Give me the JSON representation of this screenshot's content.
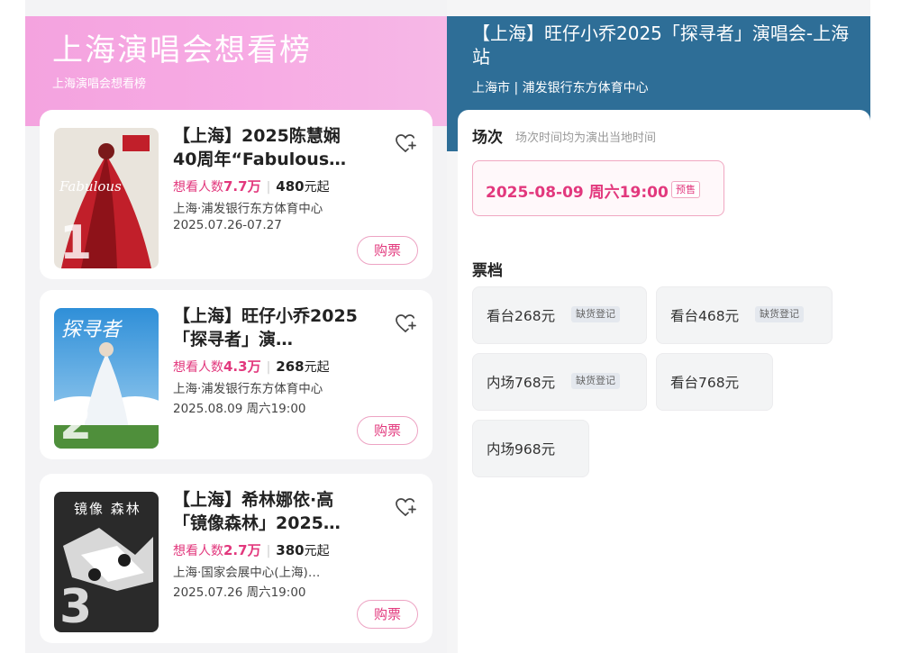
{
  "list": {
    "title": "上海演唱会想看榜",
    "subtitle": "上海演唱会想看榜",
    "want_label": "想看人数",
    "price_suffix": "元起",
    "buy_label": "购票",
    "items": [
      {
        "rank": "1",
        "title": "【上海】2025陈慧娴40周年“Fabulous…",
        "want_count": "7.7万",
        "price": "480",
        "venue": "上海·浦发银行东方体育中心",
        "date": "2025.07.26-07.27"
      },
      {
        "rank": "2",
        "title": "【上海】旺仔小乔2025「探寻者」演…",
        "want_count": "4.3万",
        "price": "268",
        "venue": "上海·浦发银行东方体育中心",
        "date": "2025.08.09 周六19:00"
      },
      {
        "rank": "3",
        "title": "【上海】希林娜依·高「镜像森林」2025…",
        "want_count": "2.7万",
        "price": "380",
        "venue": "上海·国家会展中心(上海)…",
        "date": "2025.07.26 周六19:00"
      }
    ]
  },
  "detail": {
    "title": "【上海】旺仔小乔2025「探寻者」演唱会-上海站",
    "location": "上海市 | 浦发银行东方体育中心",
    "session_section": "场次",
    "session_note": "场次时间均为演出当地时间",
    "session": {
      "datetime": "2025-08-09  周六19:00",
      "badge": "预售"
    },
    "tier_section": "票档",
    "tiers": [
      {
        "name": "看台268元",
        "badge": "缺货登记"
      },
      {
        "name": "看台468元",
        "badge": "缺货登记"
      },
      {
        "name": "内场768元",
        "badge": "缺货登记"
      },
      {
        "name": "看台768元",
        "badge": ""
      },
      {
        "name": "内场968元",
        "badge": ""
      }
    ]
  },
  "colors": {
    "accent": "#e2387d",
    "left_header": "#f6a8e2",
    "right_header": "#2e6e97"
  },
  "poster_text": [
    "Fabulous",
    "探寻者",
    "镜像 森林"
  ]
}
